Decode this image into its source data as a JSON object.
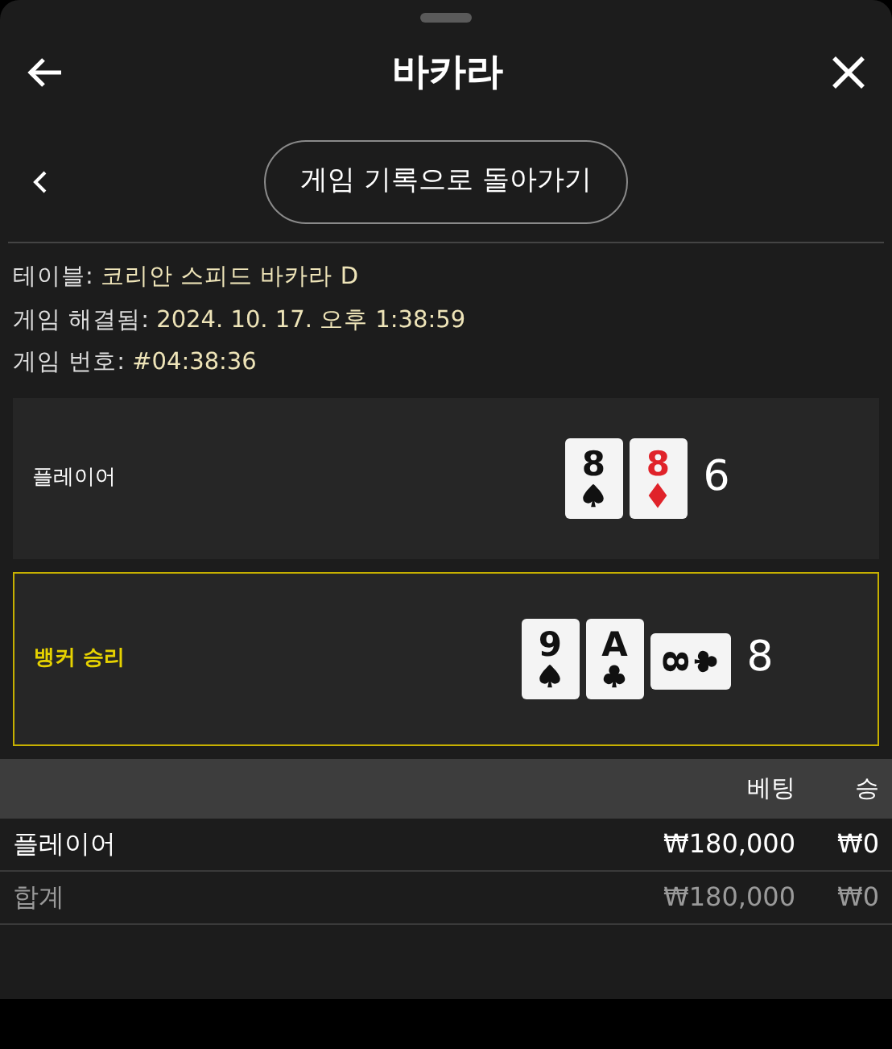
{
  "header": {
    "title": "바카라"
  },
  "back_button": {
    "label": "게임 기록으로 돌아가기"
  },
  "info": [
    {
      "label": "테이블:",
      "value": "코리안 스피드 바카라 D"
    },
    {
      "label": "게임 해결됨:",
      "value": "2024. 10. 17. 오후 1:38:59"
    },
    {
      "label": "게임 번호:",
      "value": "#04:38:36"
    }
  ],
  "hands": [
    {
      "label": "플레이어",
      "winner": false,
      "score": "6",
      "cards": [
        {
          "rank": "8",
          "kind": "spades",
          "rotated": false
        },
        {
          "rank": "8",
          "kind": "diamonds",
          "rotated": false
        }
      ]
    },
    {
      "label": "뱅커 승리",
      "winner": true,
      "score": "8",
      "cards": [
        {
          "rank": "9",
          "kind": "spades",
          "rotated": false
        },
        {
          "rank": "A",
          "kind": "clubs",
          "rotated": false
        },
        {
          "rank": "8",
          "kind": "clubs",
          "rotated": true
        }
      ]
    }
  ],
  "table": {
    "columns": [
      "베팅",
      "승"
    ],
    "rows": [
      {
        "kind": "bet",
        "label": "플레이어",
        "bet": "₩180,000",
        "win": "₩0"
      },
      {
        "kind": "total",
        "label": "합계",
        "bet": "₩180,000",
        "win": "₩0"
      }
    ]
  }
}
